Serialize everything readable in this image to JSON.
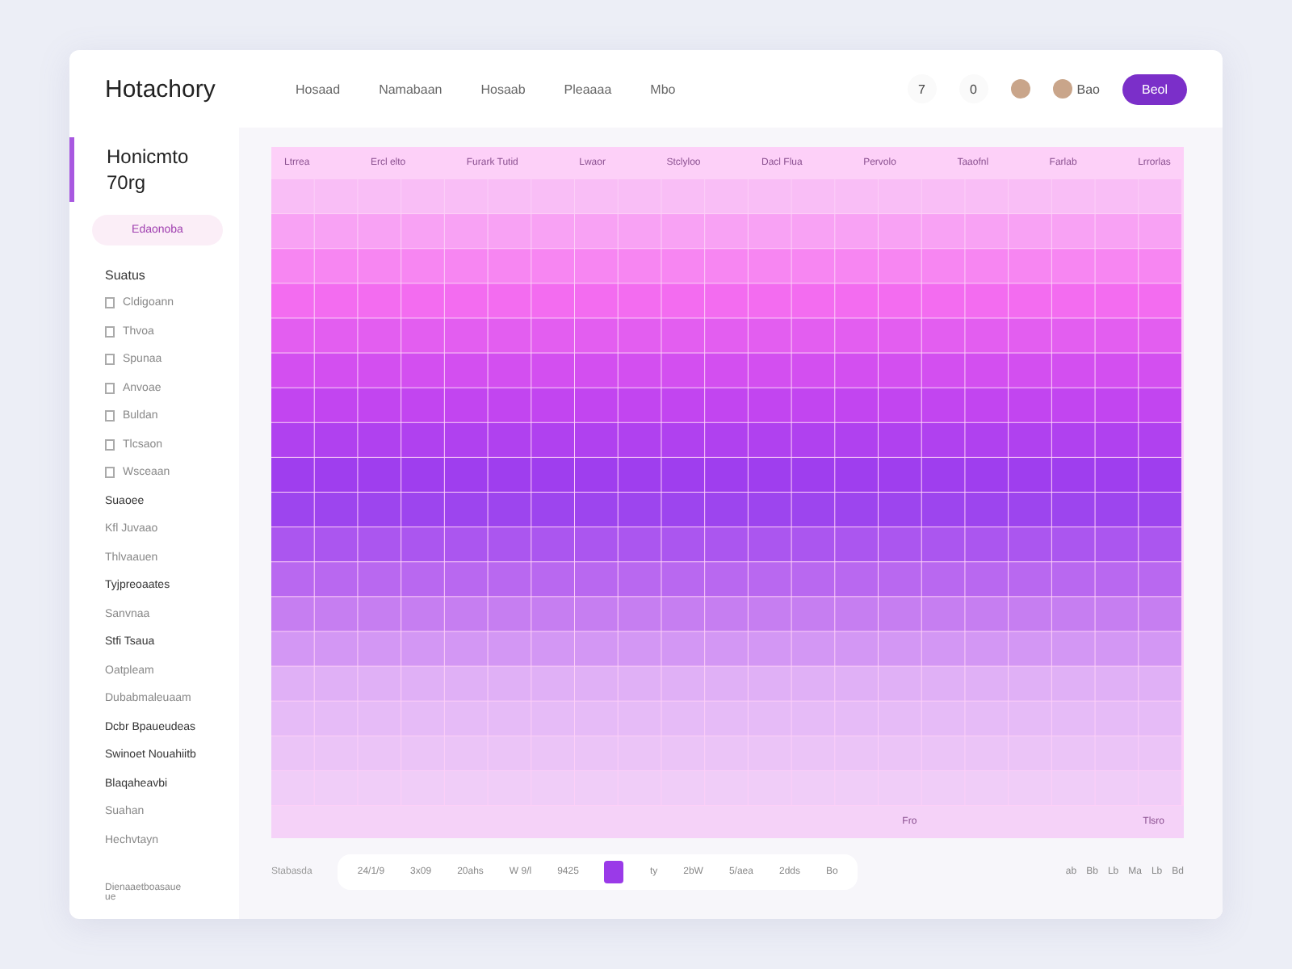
{
  "topbar": {
    "logo": "Hotachory",
    "nav": [
      "Hosaad",
      "Namabaan",
      "Hosaab",
      "Pleaaaa",
      "Mbo"
    ],
    "counters": [
      "7",
      "0"
    ],
    "user": "Bao",
    "button": "Beol"
  },
  "sidebar": {
    "heading": {
      "label": "Honicmto 70rg",
      "selected": true
    },
    "button": "Edaonoba",
    "section": "Suatus",
    "items": [
      {
        "label": "Cldigoann",
        "kind": "icon"
      },
      {
        "label": "Thvoa",
        "kind": "icon"
      },
      {
        "label": "Spunaa",
        "kind": "icon"
      },
      {
        "label": "Anvoae",
        "kind": "icon"
      },
      {
        "label": "Buldan",
        "kind": "icon"
      },
      {
        "label": "Tlcsaon",
        "kind": "icon"
      },
      {
        "label": "Wsceaan",
        "kind": "icon"
      },
      {
        "label": "Suaoee",
        "kind": "strong"
      },
      {
        "label": "Kfl Juvaao",
        "kind": "plain"
      },
      {
        "label": "Thlvaauen",
        "kind": "plain"
      },
      {
        "label": "Tyjpreoaates",
        "kind": "strong"
      },
      {
        "label": "Sanvnaa",
        "kind": "plain"
      },
      {
        "label": "Stfi Tsaua",
        "kind": "strong"
      },
      {
        "label": "Oatpleam",
        "kind": "plain"
      },
      {
        "label": "Dubabmaleuaam",
        "kind": "plain"
      },
      {
        "label": "Dcbr Bpaueudeas",
        "kind": "strong"
      },
      {
        "label": "Swinoet Nouahiitb",
        "kind": "strong"
      },
      {
        "label": "Blaqaheavbi",
        "kind": "strong"
      },
      {
        "label": "Suahan",
        "kind": "plain"
      },
      {
        "label": "Hechvtayn",
        "kind": "plain"
      }
    ],
    "footer": [
      "Dienaaetboasaue",
      "ue"
    ]
  },
  "heatmap": {
    "columns": [
      "Ltrrea",
      "Ercl elto",
      "Furark Tutid",
      "Lwaor",
      "Stclyloo",
      "Dacl Flua",
      "Pervolo",
      "Taaofnl",
      "Farlab",
      "Lrrorlas"
    ],
    "bottom_labels": [
      "Fro",
      "Tlsro"
    ]
  },
  "pager": {
    "label": "Stabasda",
    "items": [
      {
        "kind": "label",
        "label": "24/1/9"
      },
      {
        "kind": "label",
        "label": "3x09"
      },
      {
        "kind": "label",
        "label": "20ahs"
      },
      {
        "kind": "label",
        "label": "W 9/l"
      },
      {
        "kind": "label",
        "label": "9425"
      },
      {
        "kind": "handle",
        "selected": true
      },
      {
        "kind": "label",
        "label": "ty"
      },
      {
        "kind": "label",
        "label": "2bW"
      },
      {
        "kind": "label",
        "label": "5/aea"
      },
      {
        "kind": "label",
        "label": "2dds"
      },
      {
        "kind": "label",
        "label": "Bo"
      }
    ],
    "right": [
      "ab",
      "Bb",
      "Lb",
      "Ma",
      "Lb",
      "Bd"
    ]
  }
}
